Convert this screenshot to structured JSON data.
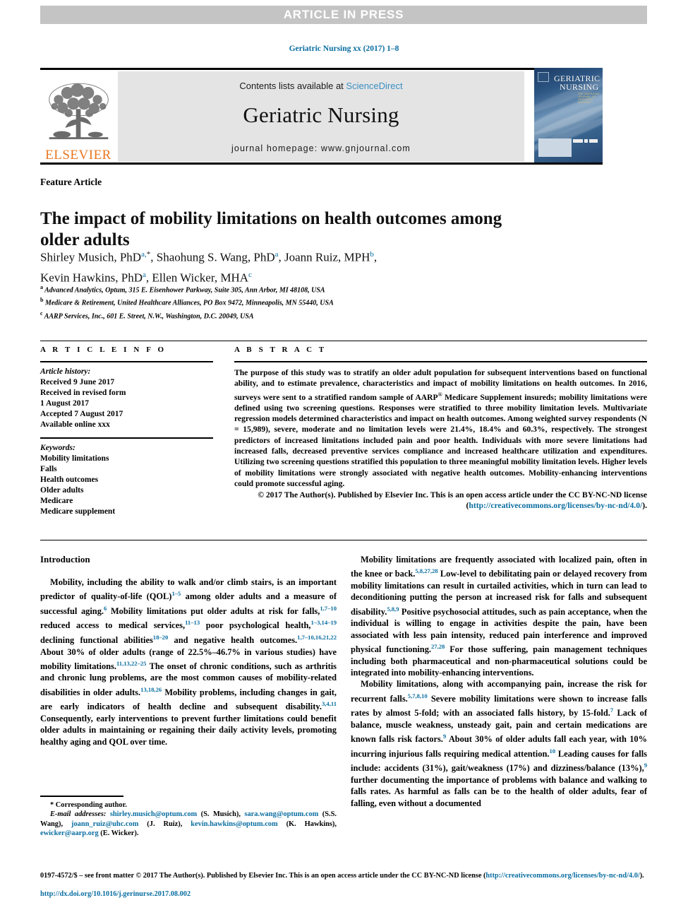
{
  "banner": {
    "text": "ARTICLE IN PRESS",
    "background_color": "#c4c4c4",
    "text_color": "#ffffff"
  },
  "running_head": "Geriatric Nursing xx (2017) 1–8",
  "masthead": {
    "contents_prefix": "Contents lists available at ",
    "contents_link": "ScienceDirect",
    "journal_name": "Geriatric Nursing",
    "homepage": "journal homepage: www.gnjournal.com",
    "publisher_logo_word": "ELSEVIER",
    "publisher_logo_color": "#e87722",
    "cover": {
      "title_line1": "GERIATRIC",
      "title_line2": "NURSING",
      "subtitle": "THE AMERICAN JOURNAL OF GERIATRIC NURSING"
    }
  },
  "article": {
    "type_label": "Feature Article",
    "title": "The impact of mobility limitations on health outcomes among older adults",
    "authors_html": "Shirley Musich, PhD<sup>a,</sup><sup class=\"plain\">*</sup>, Shaohung S. Wang, PhD<sup>a</sup>, Joann Ruiz, MPH<sup>b</sup>,<br>Kevin Hawkins, PhD<sup>a</sup>, Ellen Wicker, MHA<sup>c</sup>",
    "affiliations": [
      {
        "mark": "a",
        "text": "Advanced Analytics, Optum, 315 E. Eisenhower Parkway, Suite 305, Ann Arbor, MI 48108, USA"
      },
      {
        "mark": "b",
        "text": "Medicare & Retirement, United Healthcare Alliances, PO Box 9472, Minneapolis, MN 55440, USA"
      },
      {
        "mark": "c",
        "text": "AARP Services, Inc., 601 E. Street, N.W., Washington, D.C. 20049, USA"
      }
    ]
  },
  "article_info": {
    "heading": "A R T I C L E   I N F O",
    "history_label": "Article history:",
    "history_lines": [
      "Received 9 June 2017",
      "Received in revised form",
      "1 August 2017",
      "Accepted 7 August 2017",
      "Available online xxx"
    ],
    "keywords_label": "Keywords:",
    "keywords": [
      "Mobility limitations",
      "Falls",
      "Health outcomes",
      "Older adults",
      "Medicare",
      "Medicare supplement"
    ]
  },
  "abstract": {
    "heading": "A B S T R A C T",
    "body_html": "The purpose of this study was to stratify an older adult population for subsequent interventions based on functional ability, and to estimate prevalence, characteristics and impact of mobility limitations on health outcomes. In 2016, surveys were sent to a stratified random sample of AARP<sup>&#174;</sup> Medicare Supplement insureds; mobility limitations were defined using two screening questions. Responses were stratified to three mobility limitation levels. Multivariate regression models determined characteristics and impact on health outcomes. Among weighted survey respondents (N = 15,989), severe, moderate and no limitation levels were 21.4%, 18.4% and 60.3%, respectively. The strongest predictors of increased limitations included pain and poor health. Individuals with more severe limitations had increased falls, decreased preventive services compliance and increased healthcare utilization and expenditures. Utilizing two screening questions stratified this population to three meaningful mobility limitation levels. Higher levels of mobility limitations were strongly associated with negative health outcomes. Mobility-enhancing interventions could promote successful aging.",
    "copyright_html": "&#169; 2017 The Author(s). Published by Elsevier Inc. This is an open access article under the CC BY-NC-ND license (<a href=\"#\">http://creativecommons.org/licenses/by-nc-nd/4.0/</a>)."
  },
  "body": {
    "left_heading": "Introduction",
    "left_paragraphs_html": [
      "Mobility, including the ability to walk and/or climb stairs, is an important predictor of quality-of-life (QOL)<sup>1&#8211;5</sup> among older adults and a measure of successful aging.<sup>6</sup> Mobility limitations put older adults at risk for falls,<sup>1,7&#8211;10</sup> reduced access to medical services,<sup>11&#8211;13</sup> poor psychological health,<sup>1&#8211;3,14&#8211;19</sup> declining functional abilities<sup>18&#8211;20</sup> and negative health outcomes.<sup>1,7&#8211;10,16,21,22</sup> About 30% of older adults (range of 22.5%&#8211;46.7% in various studies) have mobility limitations.<sup>11,13,22&#8211;25</sup> The onset of chronic conditions, such as arthritis and chronic lung problems, are the most common causes of mobility-related disabilities in older adults.<sup>13,18,26</sup> Mobility problems, including changes in gait, are early indicators of health decline and subsequent disability.<sup>3,4,11</sup> Consequently, early interventions to prevent further limitations could benefit older adults in maintaining or regaining their daily activity levels, promoting healthy aging and QOL over time."
    ],
    "right_paragraphs_html": [
      "Mobility limitations are frequently associated with localized pain, often in the knee or back.<sup>5,8,27,28</sup> Low-level to debilitating pain or delayed recovery from mobility limitations can result in curtailed activities, which in turn can lead to deconditioning putting the person at increased risk for falls and subsequent disability.<sup>5,8,9</sup> Positive psychosocial attitudes, such as pain acceptance, when the individual is willing to engage in activities despite the pain, have been associated with less pain intensity, reduced pain interference and improved physical functioning.<sup>27,28</sup> For those suffering, pain management techniques including both pharmaceutical and non-pharmaceutical solutions could be integrated into mobility-enhancing interventions.",
      "Mobility limitations, along with accompanying pain, increase the risk for recurrent falls.<sup>5,7,8,10</sup> Severe mobility limitations were shown to increase falls rates by almost 5-fold; with an associated falls history, by 15-fold.<sup>7</sup> Lack of balance, muscle weakness, unsteady gait, pain and certain medications are known falls risk factors.<sup>9</sup> About 30% of older adults fall each year, with 10% incurring injurious falls requiring medical attention.<sup>10</sup> Leading causes for falls include: accidents (31%), gait/weakness (17%) and dizziness/balance (13%),<sup>9</sup> further documenting the importance of problems with balance and walking to falls rates. As harmful as falls can be to the health of older adults, fear of falling, even without a documented"
    ]
  },
  "footnote": {
    "corresponding": "* Corresponding author.",
    "email_html": "<span class=\"ital\">E-mail addresses:</span> <a href=\"#\">shirley.musich@optum.com</a> (S. Musich), <a href=\"#\">sara.wang@optum.com</a> (S.S. Wang), <a href=\"#\">joann_ruiz@uhc.com</a> (J. Ruiz), <a href=\"#\">kevin.hawkins@optum.com</a> (K. Hawkins), <a href=\"#\">ewicker@aarp.org</a> (E. Wicker)."
  },
  "bottom_matter": {
    "issn_line_html": "0197-4572/$ &#8211; see front matter &#169; 2017 The Author(s). Published by Elsevier Inc. This is an open access article under the CC BY-NC-ND license (<a href=\"#\">http://creativecommons.org/licenses/by-nc-nd/4.0/</a>).",
    "doi": "http://dx.doi.org/10.1016/j.gerinurse.2017.08.002"
  },
  "colors": {
    "link": "#0a6ea1",
    "masthead_bg": "#e4e4e4",
    "banner_bg": "#c4c4c4",
    "elsevier_orange": "#e87722"
  }
}
